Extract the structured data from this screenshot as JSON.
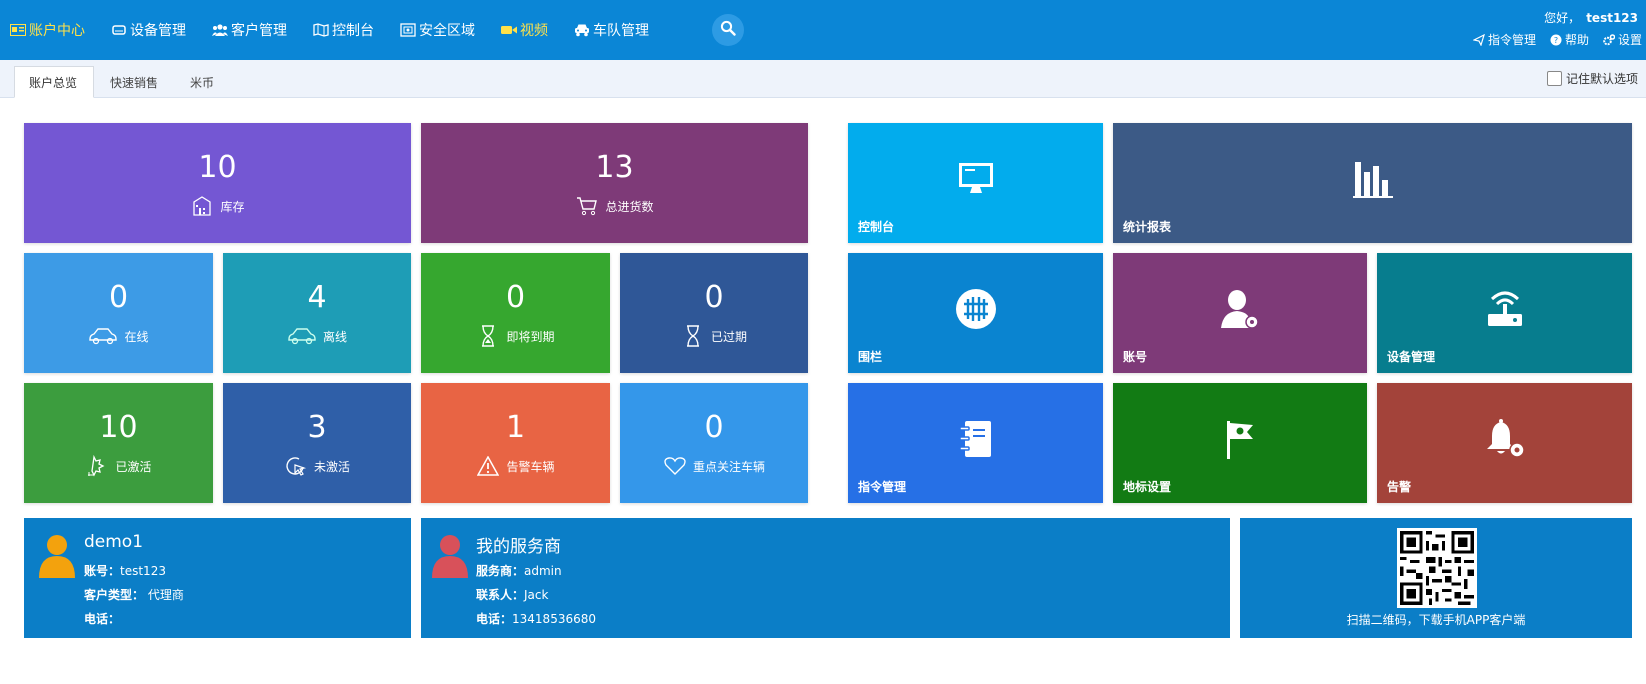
{
  "nav": {
    "items": [
      {
        "label": "账户中心",
        "icon": "id-card-icon"
      },
      {
        "label": "设备管理",
        "icon": "device-icon"
      },
      {
        "label": "客户管理",
        "icon": "users-icon"
      },
      {
        "label": "控制台",
        "icon": "map-icon"
      },
      {
        "label": "安全区域",
        "icon": "fence-icon"
      },
      {
        "label": "视频",
        "icon": "video-icon"
      },
      {
        "label": "车队管理",
        "icon": "car-icon"
      }
    ],
    "active_color": "#ffe14a",
    "bar_color": "#0b86d6"
  },
  "header": {
    "greeting": "您好，",
    "username": "test123",
    "links": [
      {
        "label": "指令管理",
        "icon": "send-icon"
      },
      {
        "label": "帮助",
        "icon": "help-icon"
      },
      {
        "label": "设置",
        "icon": "gear-icon"
      }
    ]
  },
  "tabs": [
    "账户总览",
    "快速销售",
    "米币"
  ],
  "remember_label": "记住默认选项",
  "stats": [
    {
      "value": "10",
      "label": "库存",
      "icon": "warehouse-icon",
      "color": "#7457d3"
    },
    {
      "value": "13",
      "label": "总进货数",
      "icon": "cart-icon",
      "color": "#7e3a78"
    },
    {
      "value": "0",
      "label": "在线",
      "icon": "car-online-icon",
      "color": "#3d9be6"
    },
    {
      "value": "4",
      "label": "离线",
      "icon": "car-offline-icon",
      "color": "#1e9db6"
    },
    {
      "value": "0",
      "label": "即将到期",
      "icon": "hourglass-half-icon",
      "color": "#36a72f"
    },
    {
      "value": "0",
      "label": "已过期",
      "icon": "hourglass-icon",
      "color": "#2f5797"
    },
    {
      "value": "10",
      "label": "已激活",
      "icon": "activated-icon",
      "color": "#3c9d3e"
    },
    {
      "value": "3",
      "label": "未激活",
      "icon": "pointer-icon",
      "color": "#2f5fa8"
    },
    {
      "value": "1",
      "label": "告警车辆",
      "icon": "warning-icon",
      "color": "#e86444"
    },
    {
      "value": "0",
      "label": "重点关注车辆",
      "icon": "heart-icon",
      "color": "#3497ea"
    }
  ],
  "functions": [
    {
      "label": "控制台",
      "icon": "monitor-icon",
      "color": "#02aced"
    },
    {
      "label": "统计报表",
      "icon": "bar-chart-icon",
      "color": "#3c5a86"
    },
    {
      "label": "围栏",
      "icon": "fence-circle-icon",
      "color": "#0a84d0"
    },
    {
      "label": "账号",
      "icon": "user-gear-icon",
      "color": "#7e3a78"
    },
    {
      "label": "设备管理",
      "icon": "router-icon",
      "color": "#077d8e"
    },
    {
      "label": "指令管理",
      "icon": "notebook-icon",
      "color": "#2670e6"
    },
    {
      "label": "地标设置",
      "icon": "flag-icon",
      "color": "#127b14"
    },
    {
      "label": "告警",
      "icon": "bell-gear-icon",
      "color": "#a3433a"
    }
  ],
  "account": {
    "name": "demo1",
    "rows": [
      {
        "k": "账号：",
        "v": "test123"
      },
      {
        "k": "客户类型：",
        "v": " 代理商"
      },
      {
        "k": "电话：",
        "v": ""
      }
    ]
  },
  "provider": {
    "title": "我的服务商",
    "rows": [
      {
        "k": "服务商：",
        "v": "admin"
      },
      {
        "k": "联系人：",
        "v": "Jack"
      },
      {
        "k": "电话：",
        "v": "13418536680"
      }
    ]
  },
  "qr": {
    "caption": "扫描二维码，下载手机APP客户端"
  }
}
